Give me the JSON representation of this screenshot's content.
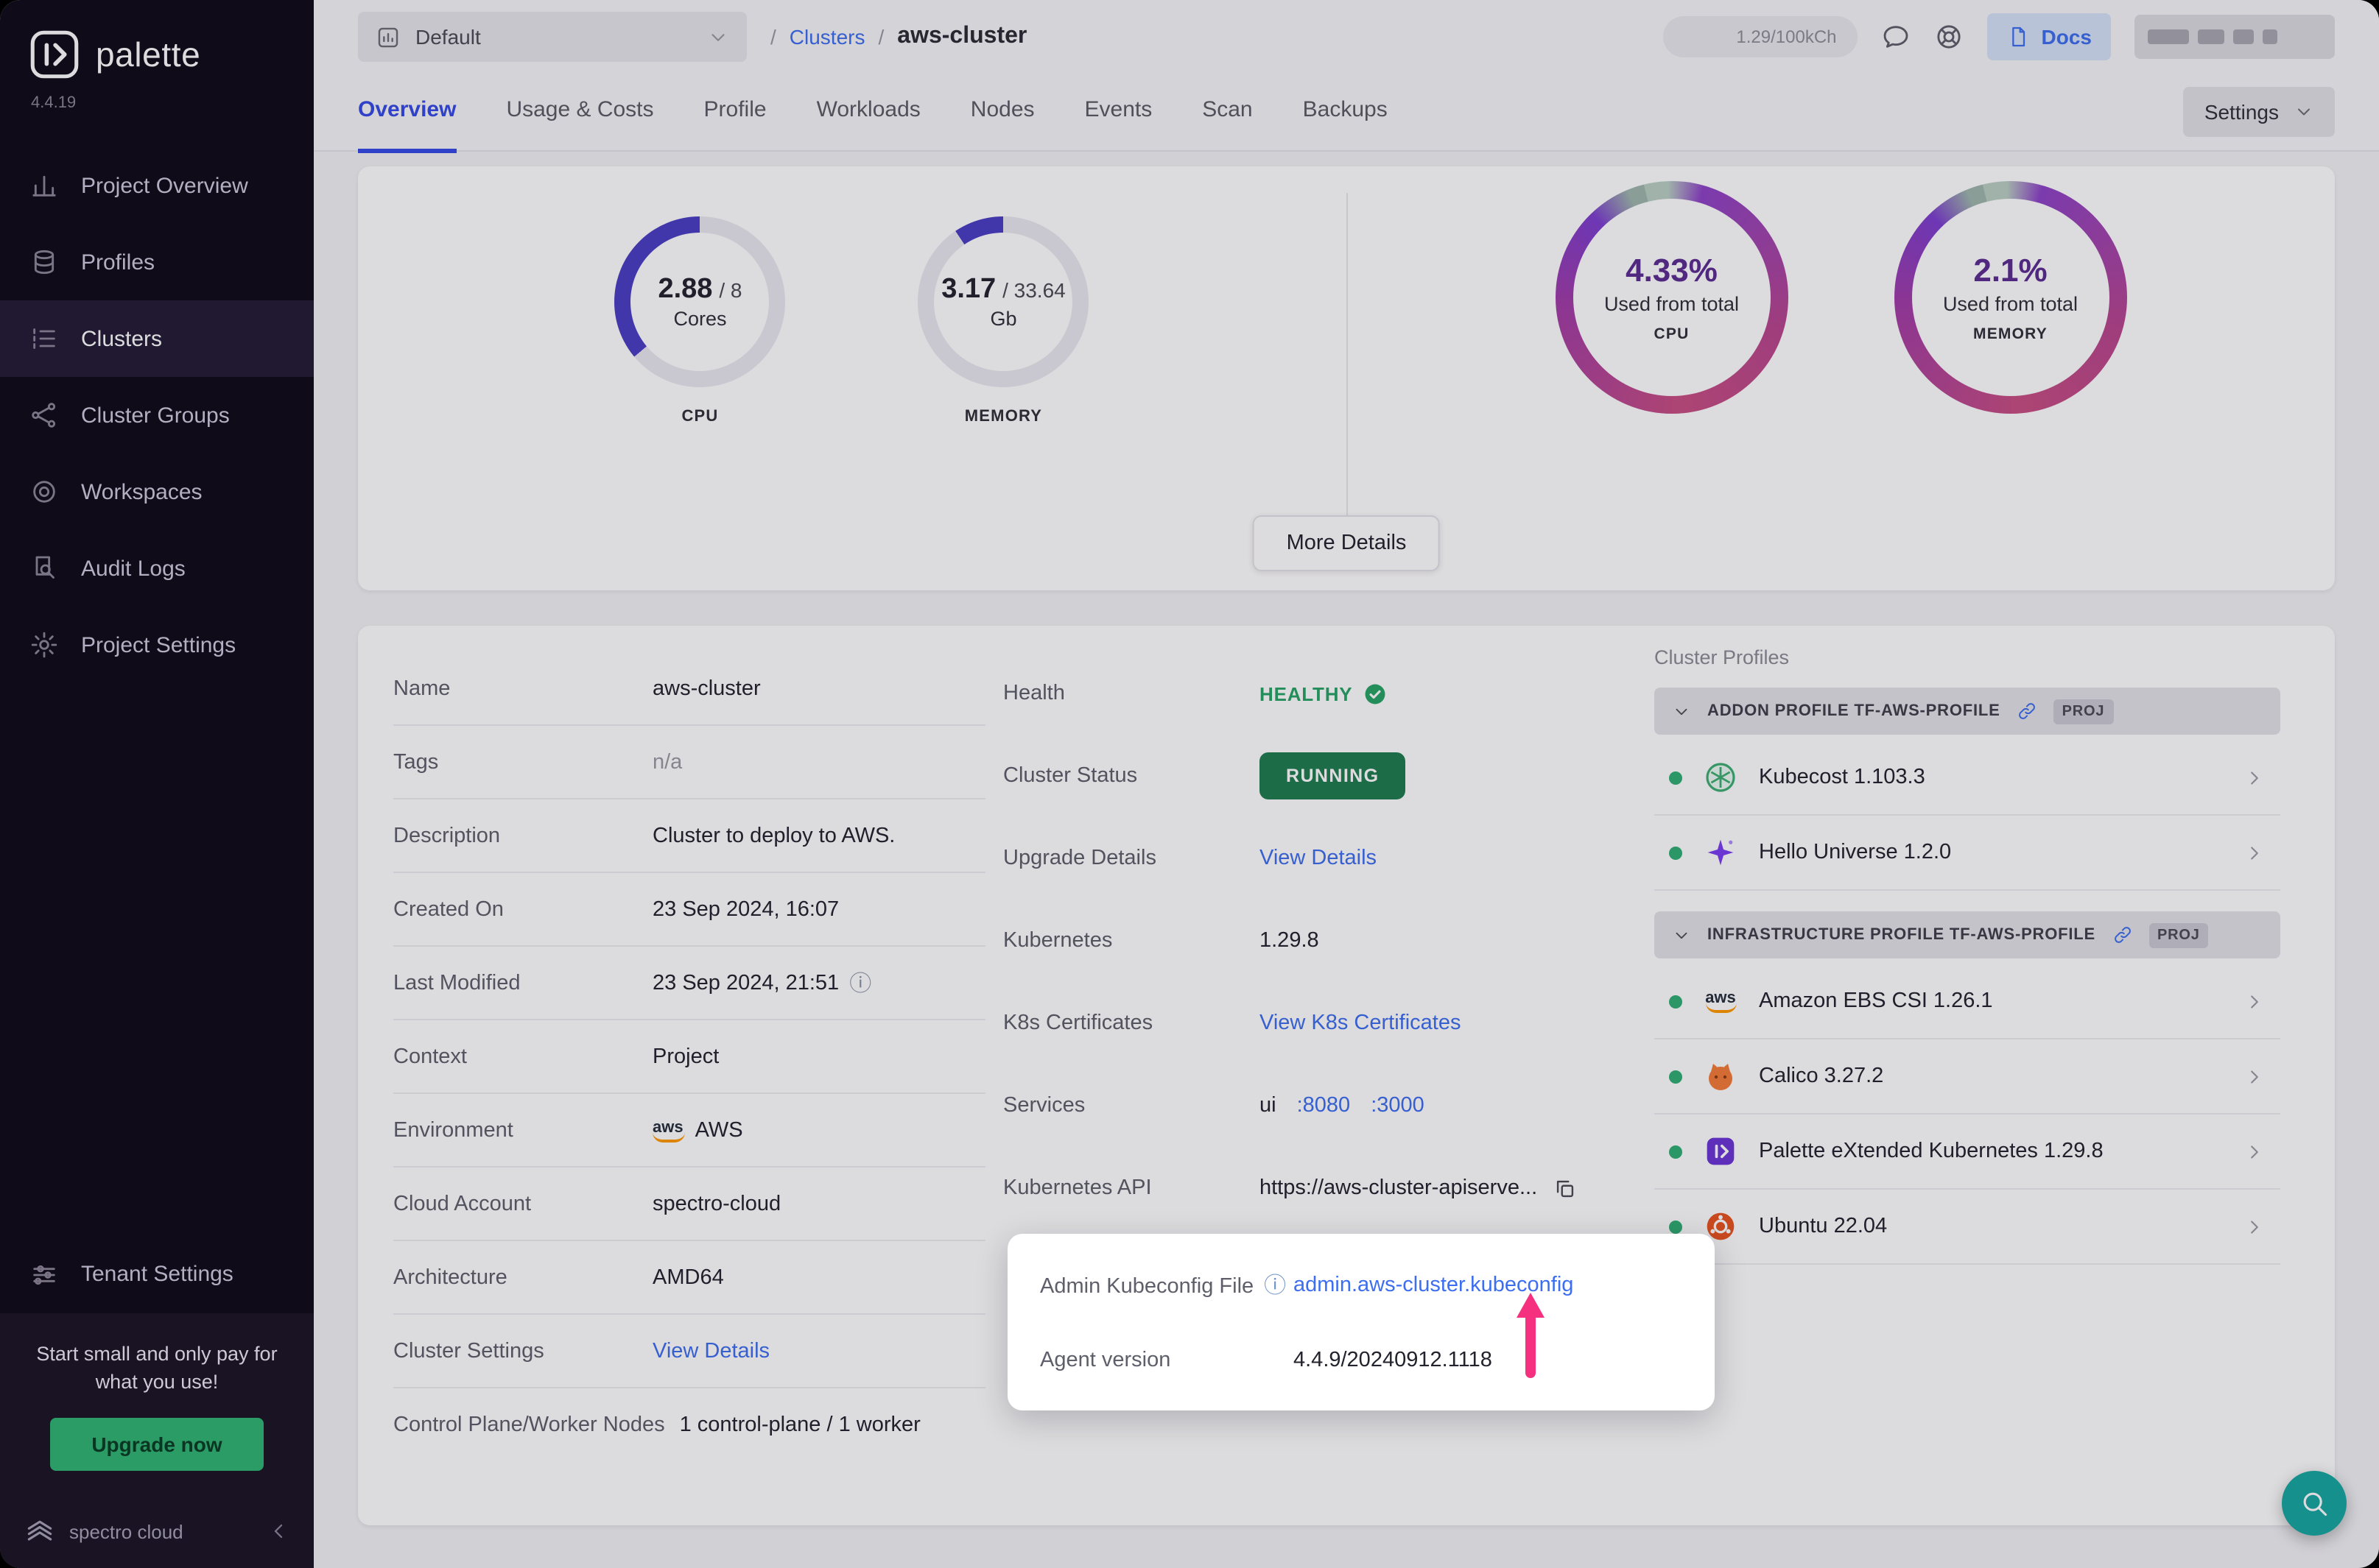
{
  "sidebar": {
    "brand": "palette",
    "version": "4.4.19",
    "items": [
      {
        "label": "Project Overview",
        "icon": "bar-chart",
        "active": false
      },
      {
        "label": "Profiles",
        "icon": "layers",
        "active": false
      },
      {
        "label": "Clusters",
        "icon": "list",
        "active": true
      },
      {
        "label": "Cluster Groups",
        "icon": "nodes",
        "active": false
      },
      {
        "label": "Workspaces",
        "icon": "target",
        "active": false
      },
      {
        "label": "Audit Logs",
        "icon": "doc-search",
        "active": false
      },
      {
        "label": "Project Settings",
        "icon": "gear",
        "active": false
      }
    ],
    "secondary_items": [
      {
        "label": "Tenant Settings",
        "icon": "sliders"
      }
    ],
    "promo": {
      "text": "Start small and only pay for what you use!",
      "cta": "Upgrade now"
    },
    "footer": {
      "brand": "spectro cloud"
    }
  },
  "topbar": {
    "project_selector": {
      "value": "Default"
    },
    "breadcrumb": {
      "separator": "/",
      "link": "Clusters",
      "current": "aws-cluster"
    },
    "usage_pill": "1.29/100kCh",
    "docs": "Docs"
  },
  "tabs": {
    "items": [
      "Overview",
      "Usage & Costs",
      "Profile",
      "Workloads",
      "Nodes",
      "Events",
      "Scan",
      "Backups"
    ],
    "active": "Overview",
    "settings_button": "Settings"
  },
  "chart_data": [
    {
      "type": "donut",
      "label": "CPU",
      "value": 2.88,
      "total": 8,
      "unit": "Cores",
      "display": "2.88 / 8",
      "fraction": 0.36
    },
    {
      "type": "donut",
      "label": "MEMORY",
      "value": 3.17,
      "total": 33.64,
      "unit": "Gb",
      "display": "3.17 / 33.64",
      "fraction": 0.094
    },
    {
      "type": "ring",
      "label": "CPU",
      "percent": 4.33,
      "display": "4.33%",
      "caption": "Used from total"
    },
    {
      "type": "ring",
      "label": "MEMORY",
      "percent": 2.1,
      "display": "2.1%",
      "caption": "Used from total"
    }
  ],
  "stats": {
    "cpu_gauge": {
      "value": "2.88",
      "total": "/ 8",
      "unit": "Cores",
      "label": "CPU"
    },
    "memory_gauge": {
      "value": "3.17",
      "total": "/ 33.64",
      "unit": "Gb",
      "label": "MEMORY"
    },
    "cpu_ring": {
      "percent": "4.33%",
      "caption": "Used from total",
      "label": "CPU"
    },
    "memory_ring": {
      "percent": "2.1%",
      "caption": "Used from total",
      "label": "MEMORY"
    },
    "more_details_button": "More Details"
  },
  "details": {
    "left_rows": [
      {
        "label": "Name",
        "value": "aws-cluster"
      },
      {
        "label": "Tags",
        "value": "n/a"
      },
      {
        "label": "Description",
        "value": "Cluster to deploy to AWS."
      },
      {
        "label": "Created On",
        "value": "23 Sep 2024, 16:07"
      },
      {
        "label": "Last Modified",
        "value": "23 Sep 2024, 21:51"
      },
      {
        "label": "Context",
        "value": "Project"
      },
      {
        "label": "Environment",
        "value": "AWS"
      },
      {
        "label": "Cloud Account",
        "value": "spectro-cloud"
      },
      {
        "label": "Architecture",
        "value": "AMD64"
      },
      {
        "label": "Cluster Settings",
        "value": "View Details"
      },
      {
        "label": "Control Plane/Worker Nodes",
        "value": "1 control-plane / 1 worker"
      }
    ],
    "middle_rows": {
      "health": {
        "label": "Health",
        "value": "HEALTHY"
      },
      "cluster_status": {
        "label": "Cluster Status",
        "value": "RUNNING"
      },
      "upgrade_details": {
        "label": "Upgrade Details",
        "value": "View Details"
      },
      "kubernetes": {
        "label": "Kubernetes",
        "value": "1.29.8"
      },
      "k8s_certificates": {
        "label": "K8s Certificates",
        "value": "View K8s Certificates"
      },
      "services": {
        "label": "Services",
        "name": "ui",
        "ports": [
          ":8080",
          ":3000"
        ]
      },
      "kubernetes_api": {
        "label": "Kubernetes API",
        "value": "https://aws-cluster-apiserve..."
      }
    },
    "spotlight": {
      "kubeconfig": {
        "label": "Admin Kubeconfig File",
        "value": "admin.aws-cluster.kubeconfig"
      },
      "agent_version": {
        "label": "Agent version",
        "value": "4.4.9/20240912.1118"
      }
    }
  },
  "profiles": {
    "title": "Cluster Profiles",
    "groups": [
      {
        "name": "ADDON PROFILE TF-AWS-PROFILE",
        "badge": "PROJ",
        "items": [
          {
            "name": "Kubecost 1.103.3",
            "icon": "kubecost"
          },
          {
            "name": "Hello Universe 1.2.0",
            "icon": "hello-universe"
          }
        ]
      },
      {
        "name": "INFRASTRUCTURE PROFILE TF-AWS-PROFILE",
        "badge": "PROJ",
        "items": [
          {
            "name": "Amazon EBS CSI 1.26.1",
            "icon": "aws-ebs"
          },
          {
            "name": "Calico 3.27.2",
            "icon": "calico"
          },
          {
            "name": "Palette eXtended Kubernetes 1.29.8",
            "icon": "palette-pxk"
          },
          {
            "name": "Ubuntu 22.04",
            "icon": "ubuntu"
          }
        ]
      }
    ]
  },
  "icons": {
    "aws_text": "aws"
  },
  "colors": {
    "accent_blue": "#3449e8",
    "link_blue": "#3d6ef0",
    "gauge_purple": "#4b3fc4",
    "gauge_track": "#e9e9f0",
    "percent_purple": "#5c2d91",
    "healthy_green": "#27a567",
    "running_green": "#1e7d4f",
    "status_dot_green": "#2fae74",
    "upgrade_green": "#2fb673",
    "fab_teal": "#17a7a0",
    "arrow_pink": "#f5317f",
    "sidebar_bg": "#0f0b18"
  }
}
